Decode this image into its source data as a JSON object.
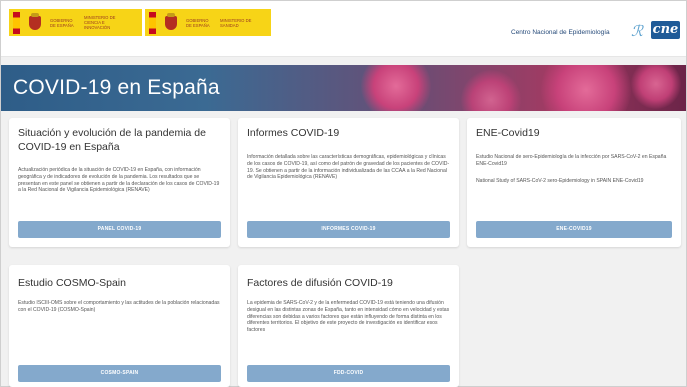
{
  "header": {
    "gov_logo_1": {
      "gobierno": "GOBIERNO DE ESPAÑA",
      "ministerio": "MINISTERIO DE CIENCIA E INNOVACIÓN"
    },
    "gov_logo_2": {
      "gobierno": "GOBIERNO DE ESPAÑA",
      "ministerio": "MINISTERIO DE SANIDAD"
    },
    "centro_link": "Centro Nacional de Epidemiología",
    "cne_logo_text": "cne"
  },
  "banner": {
    "title": "COVID-19 en España"
  },
  "cards": [
    {
      "title": "Situación y evolución de la pandemia de COVID-19 en España",
      "description": "Actualización periódica de la situación de COVID-19 en España, con información geográfica y de indicadores de evolución de la pandemia. Los resultados que se presentan en este panel se obtienen a partir de la declaración de los casos de COVID-19 a la Red Nacional de Vigilancia Epidemiológica (RENAVE)",
      "button": "PANEL COVID-19"
    },
    {
      "title": "Informes COVID-19",
      "description": "Información detallada sobre las características demográficas, epidemiológicas y clínicas de los casos de COVID-19, así como del patrón de gravedad de los pacientes de COVID-19. Se obtienen a partir de la información individualizada de las CCAA a la Red Nacional de Vigilancia Epidemiológica (RENAVE)",
      "button": "INFORMES COVID-19"
    },
    {
      "title": "ENE-Covid19",
      "description": "Estudio Nacional de sero-Epidemiología de la infección por SARS-CoV-2 en España ENE-Covid19",
      "description2": "National Study of SARS-CoV-2 sero-Epidemiology in SPAIN ENE-Covid19",
      "button": "ENE-COVID19"
    },
    {
      "title": "Estudio COSMO-Spain",
      "description": "Estudio ISCIII-OMS sobre el comportamiento y las actitudes de la población relacionadas con el COVID-19 (COSMO-Spain)",
      "button": "COSMO-SPAIN"
    },
    {
      "title": "Factores de difusión COVID-19",
      "description": "La epidemia de SARS-CoV-2 y de la enfermedad COVID-19 está teniendo una difusión desigual en las distintas zonas de España, tanto en intensidad cómo en velocidad y estas diferencias son debidas a varios factores que están influyendo de forma distinta en los diferentes territorios. El objetivo de este proyecto de investigación es identificar esos factores",
      "button": "FDD-COVID"
    }
  ],
  "colors": {
    "gov_yellow": "#f7d417",
    "button_blue": "#84a9cc",
    "cne_blue": "#1f5b98",
    "banner_virus_pink": "#c8427a"
  }
}
